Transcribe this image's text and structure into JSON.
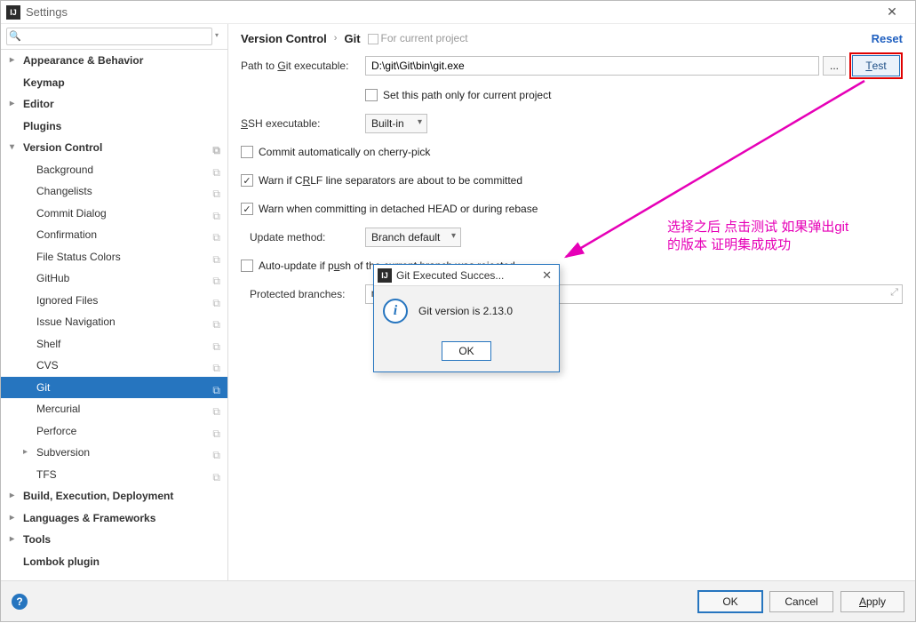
{
  "window": {
    "title": "Settings",
    "app_icon": "IJ"
  },
  "search": {
    "placeholder": ""
  },
  "sidebar": {
    "items": [
      {
        "label": "Appearance & Behavior",
        "level": 1,
        "expandable": true,
        "expanded": false,
        "bold": true
      },
      {
        "label": "Keymap",
        "level": 1,
        "bold": true
      },
      {
        "label": "Editor",
        "level": 1,
        "expandable": true,
        "expanded": false,
        "bold": true
      },
      {
        "label": "Plugins",
        "level": 1,
        "bold": true
      },
      {
        "label": "Version Control",
        "level": 1,
        "expandable": true,
        "expanded": true,
        "bold": true,
        "scope": true
      },
      {
        "label": "Background",
        "level": 2,
        "scope": true
      },
      {
        "label": "Changelists",
        "level": 2,
        "scope": true
      },
      {
        "label": "Commit Dialog",
        "level": 2,
        "scope": true
      },
      {
        "label": "Confirmation",
        "level": 2,
        "scope": true
      },
      {
        "label": "File Status Colors",
        "level": 2,
        "scope": true
      },
      {
        "label": "GitHub",
        "level": 2,
        "scope": true
      },
      {
        "label": "Ignored Files",
        "level": 2,
        "scope": true
      },
      {
        "label": "Issue Navigation",
        "level": 2,
        "scope": true
      },
      {
        "label": "Shelf",
        "level": 2,
        "scope": true
      },
      {
        "label": "CVS",
        "level": 2,
        "scope": true
      },
      {
        "label": "Git",
        "level": 2,
        "scope": true,
        "selected": true
      },
      {
        "label": "Mercurial",
        "level": 2,
        "scope": true
      },
      {
        "label": "Perforce",
        "level": 2,
        "scope": true
      },
      {
        "label": "Subversion",
        "level": 2,
        "expandable": true,
        "expanded": false,
        "scope": true
      },
      {
        "label": "TFS",
        "level": 2,
        "scope": true
      },
      {
        "label": "Build, Execution, Deployment",
        "level": 1,
        "expandable": true,
        "expanded": false,
        "bold": true
      },
      {
        "label": "Languages & Frameworks",
        "level": 1,
        "expandable": true,
        "expanded": false,
        "bold": true
      },
      {
        "label": "Tools",
        "level": 1,
        "expandable": true,
        "expanded": false,
        "bold": true
      },
      {
        "label": "Lombok plugin",
        "level": 1,
        "bold": true
      }
    ]
  },
  "breadcrumb": {
    "parent": "Version Control",
    "current": "Git",
    "badge": "For current project",
    "reset": "Reset"
  },
  "form": {
    "path_label": "Path to Git executable:",
    "path_value": "D:\\git\\Git\\bin\\git.exe",
    "browse_label": "...",
    "test_label": "Test",
    "set_only_project": "Set this path only for current project",
    "ssh_label": "SSH executable:",
    "ssh_value": "Built-in",
    "cb_cherry": "Commit automatically on cherry-pick",
    "cb_crlf": "Warn if CRLF line separators are about to be committed",
    "cb_detached": "Warn when committing in detached HEAD or during rebase",
    "update_label": "Update method:",
    "update_value": "Branch default",
    "cb_autoupdate": "Auto-update if push of the current branch was rejected",
    "protected_label": "Protected branches:",
    "protected_value": "mas"
  },
  "footer": {
    "ok": "OK",
    "cancel": "Cancel",
    "apply": "Apply"
  },
  "dialog": {
    "title": "Git Executed Succes...",
    "message": "Git version is 2.13.0",
    "ok": "OK"
  },
  "annotation": {
    "line1": "选择之后 点击测试 如果弹出git",
    "line2": "的版本 证明集成成功"
  }
}
